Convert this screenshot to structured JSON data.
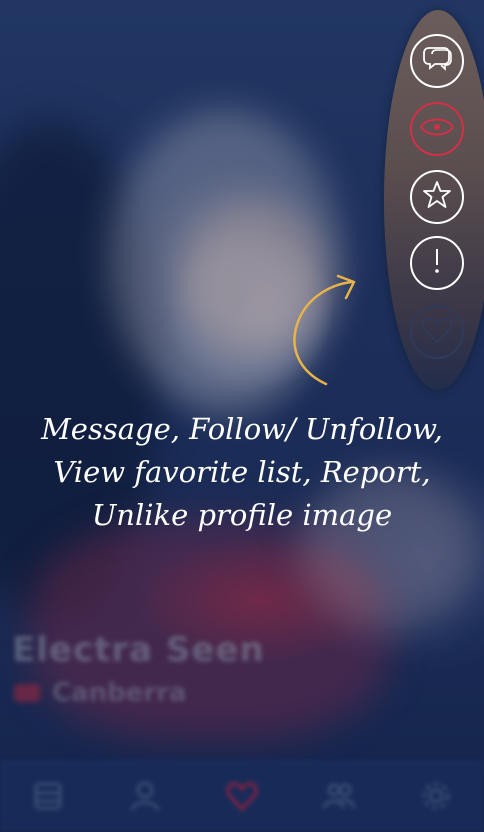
{
  "background": {
    "profile_name_blurred": "Electra Seen",
    "profile_location_blurred": "Canberra"
  },
  "actions": [
    {
      "name": "message",
      "icon": "chat-bubbles-icon",
      "color": "#ffffff"
    },
    {
      "name": "follow-unfollow",
      "icon": "eye-icon",
      "color": "#d32f47"
    },
    {
      "name": "view-favorite-list",
      "icon": "star-icon",
      "color": "#ffffff"
    },
    {
      "name": "report",
      "icon": "exclamation-icon",
      "color": "#ffffff"
    },
    {
      "name": "unlike-profile-image",
      "icon": "heart-icon",
      "color": "#2f3b5a"
    }
  ],
  "hint": {
    "arrow_color": "#e7b34a",
    "lines": [
      "Message, Follow/ Unfollow,",
      "View favorite list, Report,",
      "Unlike profile image"
    ]
  },
  "tabbar": {
    "tabs": [
      {
        "name": "home",
        "icon": "grid-icon"
      },
      {
        "name": "profile",
        "icon": "person-icon"
      },
      {
        "name": "center",
        "icon": "heart-logo-icon",
        "active": true
      },
      {
        "name": "people",
        "icon": "people-icon"
      },
      {
        "name": "settings",
        "icon": "gear-icon"
      }
    ]
  }
}
